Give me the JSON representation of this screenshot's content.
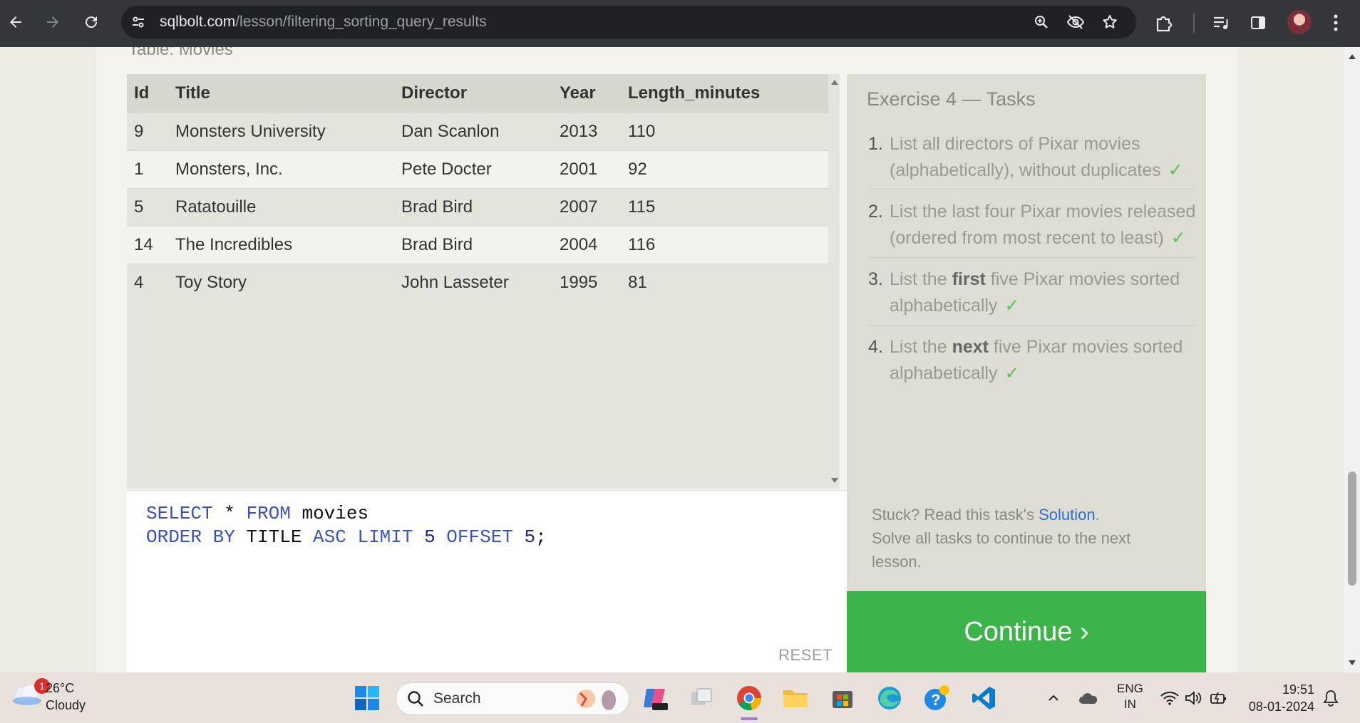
{
  "browser": {
    "url_host": "sqlbolt.com",
    "url_path": "/lesson/filtering_sorting_query_results"
  },
  "lesson": {
    "table_caption": "Table: Movies",
    "columns": [
      "Id",
      "Title",
      "Director",
      "Year",
      "Length_minutes"
    ],
    "rows": [
      [
        "9",
        "Monsters University",
        "Dan Scanlon",
        "2013",
        "110"
      ],
      [
        "1",
        "Monsters, Inc.",
        "Pete Docter",
        "2001",
        "92"
      ],
      [
        "5",
        "Ratatouille",
        "Brad Bird",
        "2007",
        "115"
      ],
      [
        "14",
        "The Incredibles",
        "Brad Bird",
        "2004",
        "116"
      ],
      [
        "4",
        "Toy Story",
        "John Lasseter",
        "1995",
        "81"
      ]
    ],
    "query": {
      "line1": {
        "select": "SELECT",
        "star": " * ",
        "from": "FROM",
        "table": " movies"
      },
      "line2": {
        "order": "ORDER BY",
        "col": " TITLE ",
        "asc": "ASC",
        "limit": " LIMIT ",
        "limit_val": "5",
        "offset": " OFFSET ",
        "offset_val": "5",
        "end": ";"
      }
    },
    "reset_label": "RESET"
  },
  "exercise": {
    "title": "Exercise 4 — Tasks",
    "check_glyph": "✓",
    "tasks": [
      {
        "num": "1.",
        "pre": "List all directors of Pixar movies (alphabetically), without duplicates",
        "bold": "",
        "post": ""
      },
      {
        "num": "2.",
        "pre": "List the last four Pixar movies released (ordered from most recent to least)",
        "bold": "",
        "post": ""
      },
      {
        "num": "3.",
        "pre": "List the ",
        "bold": "first",
        "post": " five Pixar movies sorted alphabetically"
      },
      {
        "num": "4.",
        "pre": "List the ",
        "bold": "next",
        "post": " five Pixar movies sorted alphabetically"
      }
    ],
    "stuck_pre": "Stuck? Read this task's ",
    "solution_link": "Solution",
    "stuck_post": ".",
    "solve_all": "Solve all tasks to continue to the next lesson.",
    "continue_label": "Continue ›"
  },
  "taskbar": {
    "weather_badge": "1",
    "temperature": "26°C",
    "condition": "Cloudy",
    "search_label": "Search",
    "lang_line1": "ENG",
    "lang_line2": "IN",
    "time": "19:51",
    "date": "08-01-2024"
  },
  "colors": {
    "continue_green": "#3cb44a",
    "sql_keyword": "#3b53b8",
    "check_green": "#5fbf5f",
    "link_blue": "#2e6ed1"
  }
}
